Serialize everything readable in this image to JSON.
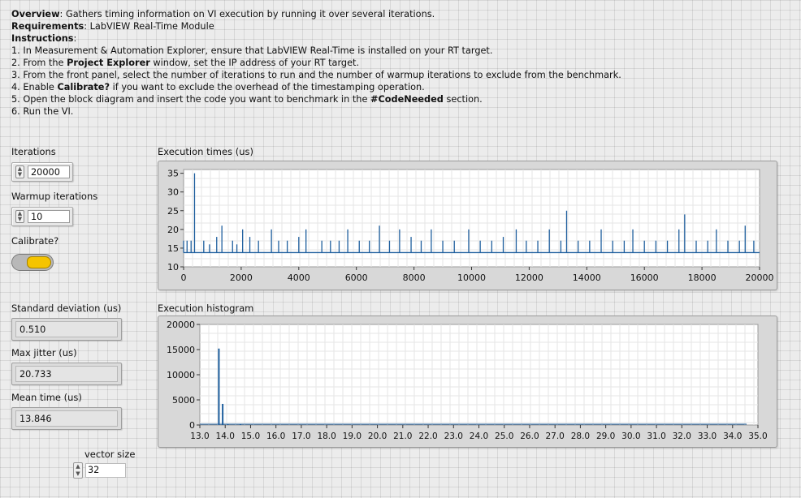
{
  "instructions": {
    "overview_label": "Overview",
    "overview_text": ": Gathers timing information on VI execution by running it over several iterations.",
    "requirements_label": "Requirements",
    "requirements_text": ": LabVIEW Real-Time Module",
    "instructions_label": "Instructions",
    "instructions_colon": ":",
    "step1": "1. In Measurement & Automation Explorer, ensure that LabVIEW Real-Time is installed on your RT target.",
    "step2_a": "2. From the ",
    "step2_b": "Project Explorer",
    "step2_c": " window, set the IP address of your RT target.",
    "step3": "3. From the front panel, select the number of iterations to run and the number of warmup iterations to exclude from the benchmark.",
    "step4_a": "4. Enable ",
    "step4_b": "Calibrate?",
    "step4_c": " if you want to exclude the overhead of the timestamping operation.",
    "step5_a": "5. Open the block diagram and insert the code you want to benchmark in the ",
    "step5_b": "#CodeNeeded",
    "step5_c": " section.",
    "step6": "6. Run the VI."
  },
  "controls": {
    "iterations_label": "Iterations",
    "iterations_value": "20000",
    "warmup_label": "Warmup iterations",
    "warmup_value": "10",
    "calibrate_label": "Calibrate?",
    "calibrate_state": "on",
    "stddev_label": "Standard deviation (us)",
    "stddev_value": "0.510",
    "maxjitter_label": "Max jitter (us)",
    "maxjitter_value": "20.733",
    "mean_label": "Mean time (us)",
    "mean_value": "13.846",
    "vector_size_label": "vector size",
    "vector_size_value": "32"
  },
  "colors": {
    "plot_line": "#1f5f9e",
    "toggle_on": "#f5c400",
    "panel_bg": "#ececec"
  },
  "chart_data": [
    {
      "type": "line",
      "title": "Execution times (us)",
      "xlabel": "",
      "ylabel": "",
      "xlim": [
        0,
        20000
      ],
      "ylim": [
        10,
        36
      ],
      "xticks": [
        0,
        2000,
        4000,
        6000,
        8000,
        10000,
        12000,
        14000,
        16000,
        18000,
        20000
      ],
      "yticks": [
        10,
        15,
        20,
        25,
        30,
        35
      ],
      "baseline": 13.8,
      "spikes": [
        {
          "x": 0,
          "y": 17
        },
        {
          "x": 120,
          "y": 17
        },
        {
          "x": 260,
          "y": 17
        },
        {
          "x": 380,
          "y": 35
        },
        {
          "x": 700,
          "y": 17
        },
        {
          "x": 900,
          "y": 16
        },
        {
          "x": 1150,
          "y": 18
        },
        {
          "x": 1330,
          "y": 21
        },
        {
          "x": 1700,
          "y": 17
        },
        {
          "x": 1850,
          "y": 16
        },
        {
          "x": 2050,
          "y": 20
        },
        {
          "x": 2300,
          "y": 18
        },
        {
          "x": 2600,
          "y": 17
        },
        {
          "x": 3050,
          "y": 20
        },
        {
          "x": 3300,
          "y": 17
        },
        {
          "x": 3600,
          "y": 17
        },
        {
          "x": 4000,
          "y": 18
        },
        {
          "x": 4250,
          "y": 20
        },
        {
          "x": 4800,
          "y": 17
        },
        {
          "x": 5100,
          "y": 17
        },
        {
          "x": 5400,
          "y": 17
        },
        {
          "x": 5700,
          "y": 20
        },
        {
          "x": 6100,
          "y": 17
        },
        {
          "x": 6450,
          "y": 17
        },
        {
          "x": 6800,
          "y": 21
        },
        {
          "x": 7150,
          "y": 17
        },
        {
          "x": 7500,
          "y": 20
        },
        {
          "x": 7900,
          "y": 18
        },
        {
          "x": 8250,
          "y": 17
        },
        {
          "x": 8600,
          "y": 20
        },
        {
          "x": 9000,
          "y": 17
        },
        {
          "x": 9400,
          "y": 17
        },
        {
          "x": 9900,
          "y": 20
        },
        {
          "x": 10300,
          "y": 17
        },
        {
          "x": 10700,
          "y": 17
        },
        {
          "x": 11100,
          "y": 18
        },
        {
          "x": 11550,
          "y": 20
        },
        {
          "x": 11900,
          "y": 17
        },
        {
          "x": 12300,
          "y": 17
        },
        {
          "x": 12700,
          "y": 20
        },
        {
          "x": 13100,
          "y": 17
        },
        {
          "x": 13300,
          "y": 25
        },
        {
          "x": 13700,
          "y": 17
        },
        {
          "x": 14100,
          "y": 17
        },
        {
          "x": 14500,
          "y": 20
        },
        {
          "x": 14900,
          "y": 17
        },
        {
          "x": 15300,
          "y": 17
        },
        {
          "x": 15600,
          "y": 20
        },
        {
          "x": 16000,
          "y": 17
        },
        {
          "x": 16400,
          "y": 17
        },
        {
          "x": 16800,
          "y": 17
        },
        {
          "x": 17200,
          "y": 20
        },
        {
          "x": 17400,
          "y": 24
        },
        {
          "x": 17800,
          "y": 17
        },
        {
          "x": 18200,
          "y": 17
        },
        {
          "x": 18500,
          "y": 20
        },
        {
          "x": 18900,
          "y": 17
        },
        {
          "x": 19300,
          "y": 17
        },
        {
          "x": 19500,
          "y": 21
        },
        {
          "x": 19800,
          "y": 17
        }
      ]
    },
    {
      "type": "bar",
      "title": "Execution histogram",
      "xlabel": "",
      "ylabel": "",
      "xlim": [
        13.0,
        35.0
      ],
      "ylim": [
        0,
        20000
      ],
      "xticks": [
        "13.0",
        "14.0",
        "15.0",
        "16.0",
        "17.0",
        "18.0",
        "19.0",
        "20.0",
        "21.0",
        "22.0",
        "23.0",
        "24.0",
        "25.0",
        "26.0",
        "27.0",
        "28.0",
        "29.0",
        "30.0",
        "31.0",
        "32.0",
        "33.0",
        "34.0",
        "35.0"
      ],
      "yticks": [
        0,
        5000,
        10000,
        15000,
        20000
      ],
      "bars": [
        {
          "x": 13.75,
          "y": 15200
        },
        {
          "x": 13.9,
          "y": 4200
        },
        {
          "x": 14.1,
          "y": 200
        },
        {
          "x": 14.6,
          "y": 80
        }
      ]
    }
  ]
}
